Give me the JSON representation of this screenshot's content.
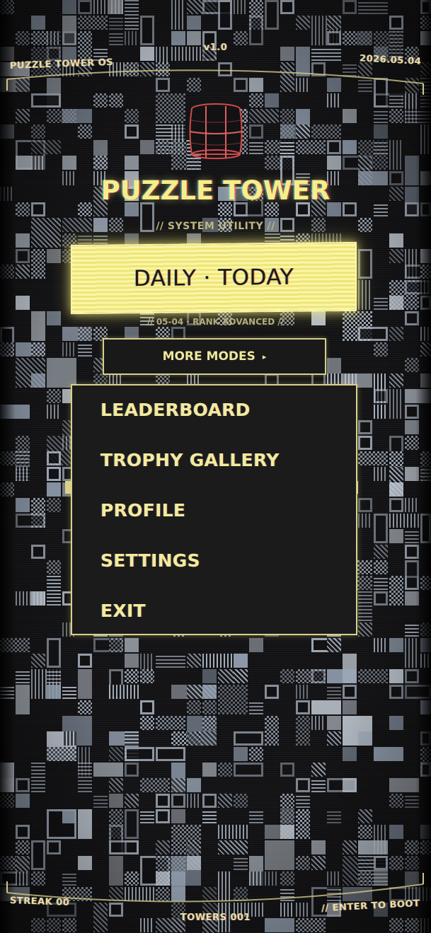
{
  "hud": {
    "top_left": "PUZZLE TOWER OS",
    "top_center": "v1.0",
    "top_right": "2026.05.04",
    "bottom_left": "STREAK 00",
    "bottom_center": "TOWERS 001",
    "bottom_right": "// ENTER TO BOOT"
  },
  "title": {
    "game_title": "PUZZLE TOWER",
    "subtitle": "// SYSTEM UTILITY //"
  },
  "daily": {
    "label": "DAILY · TODAY",
    "detail": "// 05-04 · RANK ADVANCED //"
  },
  "more_modes": {
    "label": "MORE MODES",
    "arrow": "▸"
  },
  "menu": {
    "items": [
      {
        "label": "LEADERBOARD"
      },
      {
        "label": "TROPHY GALLERY"
      },
      {
        "label": "PROFILE"
      },
      {
        "label": "SETTINGS"
      },
      {
        "label": "EXIT"
      }
    ]
  },
  "colors": {
    "accent": "#f5ee8a",
    "panel": "#1b1b1c",
    "background": "#121214",
    "tile": "#aeb8c6"
  },
  "icons": {
    "logo": "tower-barrel-icon"
  }
}
